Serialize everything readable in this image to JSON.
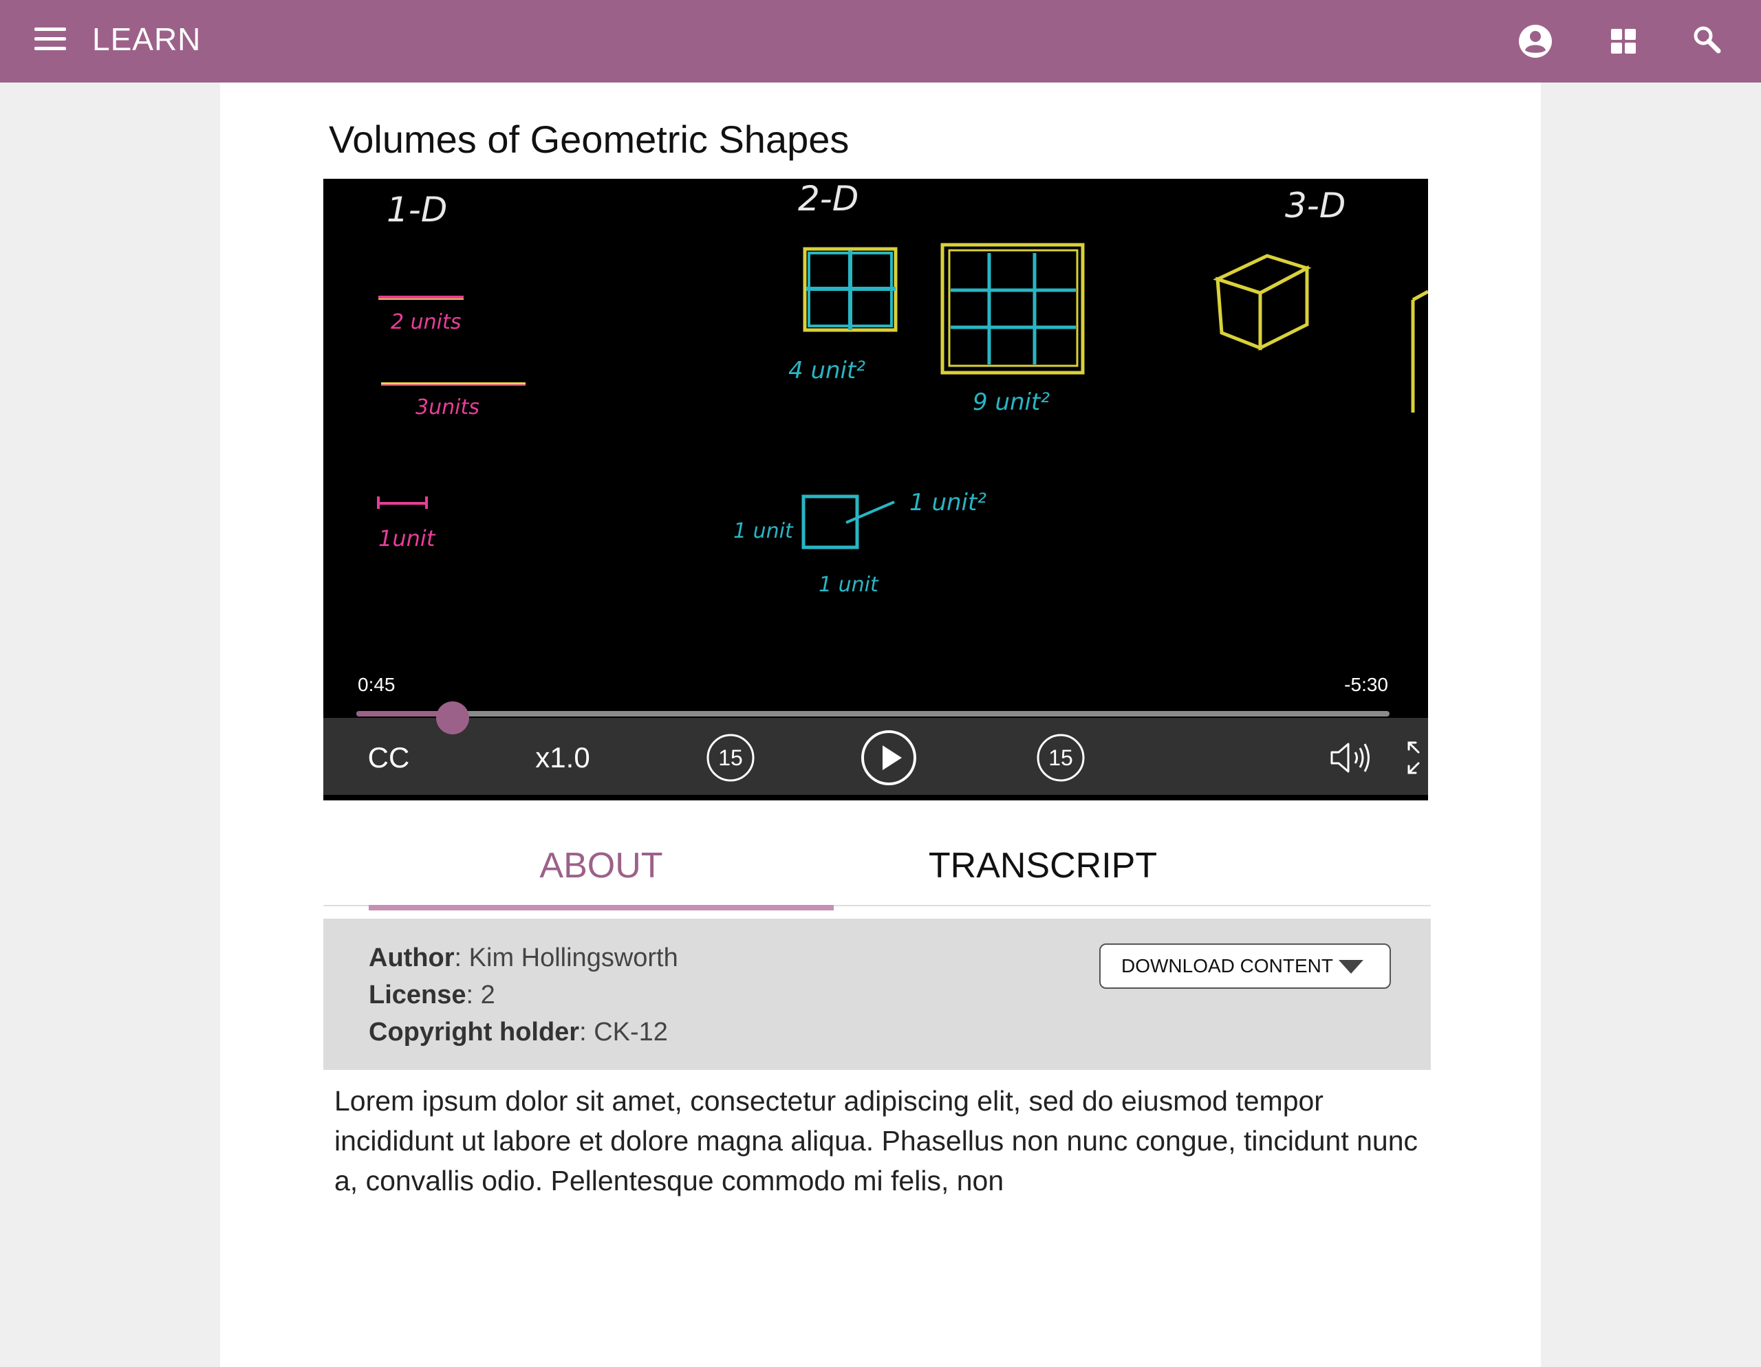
{
  "header": {
    "brand": "LEARN",
    "color": "#9c6189",
    "icons": [
      "menu-icon",
      "account-icon",
      "apps-grid-icon",
      "search-icon"
    ]
  },
  "page": {
    "title": "Volumes of Geometric Shapes"
  },
  "video": {
    "board_labels": {
      "col1": "1-D",
      "col2": "2-D",
      "col3": "3-D",
      "two_units": "2 units",
      "three_units": "3units",
      "one_unit": "1unit",
      "four_unit2": "4 unit²",
      "nine_unit2": "9 unit²",
      "one_unit_left": "1 unit",
      "one_unit_bottom": "1 unit",
      "one_unit2": "1 unit²"
    },
    "current_time": "0:45",
    "remaining_time": "-5:30",
    "progress": 0.093,
    "controls": {
      "cc": "CC",
      "speed": "x1.0",
      "skip_back": "15",
      "skip_forward": "15"
    }
  },
  "tabs": [
    {
      "label": "ABOUT",
      "active": true
    },
    {
      "label": "TRANSCRIPT",
      "active": false
    }
  ],
  "about": {
    "author_label": "Author",
    "author": "Kim Hollingsworth",
    "license_label": "License",
    "license": "2",
    "copyright_label": "Copyright holder",
    "copyright": "CK-12",
    "download_label": "DOWNLOAD CONTENT"
  },
  "description": "Lorem ipsum dolor sit amet, consectetur adipiscing elit, sed do eiusmod tempor incididunt ut labore et dolore magna aliqua. Phasellus non nunc congue, tincidunt nunc a, convallis odio. Pellentesque commodo mi felis, non"
}
